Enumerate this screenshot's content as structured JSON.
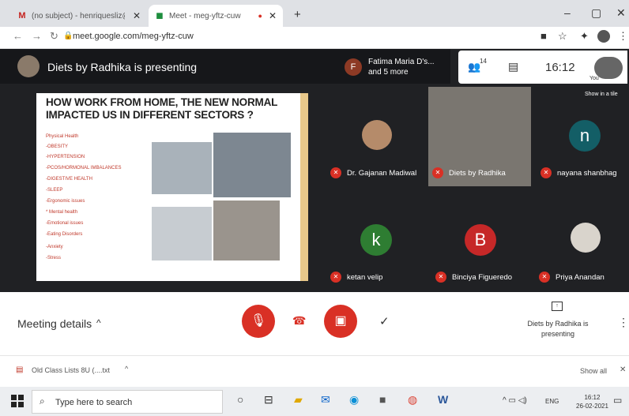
{
  "browser": {
    "tabs": [
      {
        "label": "(no subject) - henriquesliz@gmai",
        "icon": "gmail-icon"
      },
      {
        "label": "Meet - meg-yftz-cuw",
        "icon": "meet-icon"
      }
    ],
    "url": "meet.google.com/meg-yftz-cuw"
  },
  "meet": {
    "presenting_banner": "Diets by Radhika is presenting",
    "participants_preview": {
      "initial": "F",
      "name": "Fatima Maria D's...",
      "more": "and 5 more"
    },
    "people_count": "14",
    "time": "16:12",
    "you_label": "You",
    "show_in_tile": "Show in a tile",
    "slide": {
      "title": "HOW WORK FROM HOME, THE NEW NORMAL IMPACTED US IN DIFFERENT SECTORS ?",
      "items": [
        "Physical Health",
        "-OBESITY",
        "-HYPERTENSION",
        "-PCOS/HORMONAL IMBALANCES",
        "-DIGESTIVE HEALTH",
        "-SLEEP",
        "-Ergonomic issues",
        "* Mental health",
        "-Emotional issues",
        "-Eating Disorders",
        "-Anxiety",
        "-Stress"
      ]
    },
    "tiles": [
      {
        "name": "Dr. Gajanan Madiwal"
      },
      {
        "name": "Diets by Radhika"
      },
      {
        "name": "nayana shanbhag",
        "initial": "n"
      },
      {
        "name": "ketan velip",
        "initial": "k"
      },
      {
        "name": "Binciya Figueredo",
        "initial": "B"
      },
      {
        "name": "Priya Anandan"
      }
    ],
    "meeting_details": "Meeting details",
    "presenting_status": "Diets by Radhika is presenting",
    "colors": {
      "accent_red": "#d93025",
      "nayana_av": "#135e66",
      "ketan_av": "#2e7d32",
      "binciya_av": "#c62828"
    }
  },
  "download": {
    "file": "Old Class Lists 8U (....txt",
    "show_all": "Show all"
  },
  "taskbar": {
    "search_placeholder": "Type here to search",
    "lang": "ENG",
    "time": "16:12",
    "date": "26-02-2021"
  }
}
